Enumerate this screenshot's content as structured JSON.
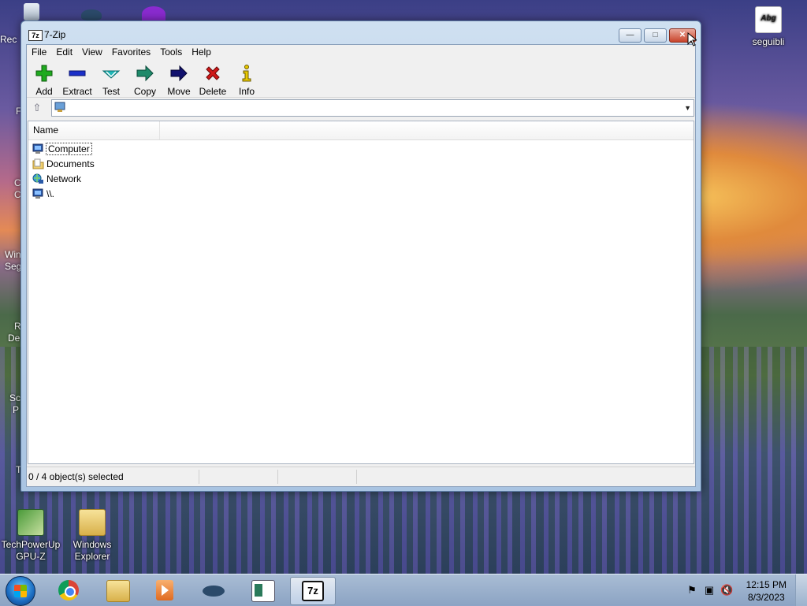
{
  "desktop": {
    "top_right_icon": {
      "label": "seguibli",
      "glyph_text": "Abg"
    },
    "bottom_icons": [
      {
        "label": "TechPowerUp GPU-Z"
      },
      {
        "label": "Windows Explorer"
      }
    ],
    "edge_labels": [
      "Rec",
      "F",
      "C",
      "C",
      "Win",
      "Seg",
      "R",
      "De",
      "Sc",
      "P",
      "T"
    ]
  },
  "window": {
    "title": "7-Zip",
    "title_icon_text": "7z",
    "menu": [
      "File",
      "Edit",
      "View",
      "Favorites",
      "Tools",
      "Help"
    ],
    "toolbar": [
      {
        "label": "Add",
        "icon": "plus-icon",
        "color": "#1faa1f"
      },
      {
        "label": "Extract",
        "icon": "minus-icon",
        "color": "#1a2fc8"
      },
      {
        "label": "Test",
        "icon": "check-icon",
        "color": "#1fb8b8"
      },
      {
        "label": "Copy",
        "icon": "arrow-right-icon",
        "color": "#1e8a6a"
      },
      {
        "label": "Move",
        "icon": "arrow-right-icon",
        "color": "#12126e"
      },
      {
        "label": "Delete",
        "icon": "x-icon",
        "color": "#d01818"
      },
      {
        "label": "Info",
        "icon": "info-icon",
        "color": "#e8c800"
      }
    ],
    "address": {
      "value": ""
    },
    "columns": [
      "Name"
    ],
    "items": [
      {
        "label": "Computer",
        "icon": "computer-icon",
        "focused": true
      },
      {
        "label": "Documents",
        "icon": "folder-icon",
        "focused": false
      },
      {
        "label": "Network",
        "icon": "network-icon",
        "focused": false
      },
      {
        "label": "\\\\.",
        "icon": "computer-icon",
        "focused": false
      }
    ],
    "status": "0 / 4 object(s) selected"
  },
  "taskbar": {
    "apps": [
      {
        "name": "chrome-icon",
        "active": false
      },
      {
        "name": "file-explorer-icon",
        "active": false
      },
      {
        "name": "media-player-icon",
        "active": false
      },
      {
        "name": "ufo-app-icon",
        "active": false
      },
      {
        "name": "reader-app-icon",
        "active": false
      },
      {
        "name": "7zip-icon",
        "active": true,
        "text": "7z"
      }
    ],
    "clock": {
      "time": "12:15 PM",
      "date": "8/3/2023"
    }
  }
}
